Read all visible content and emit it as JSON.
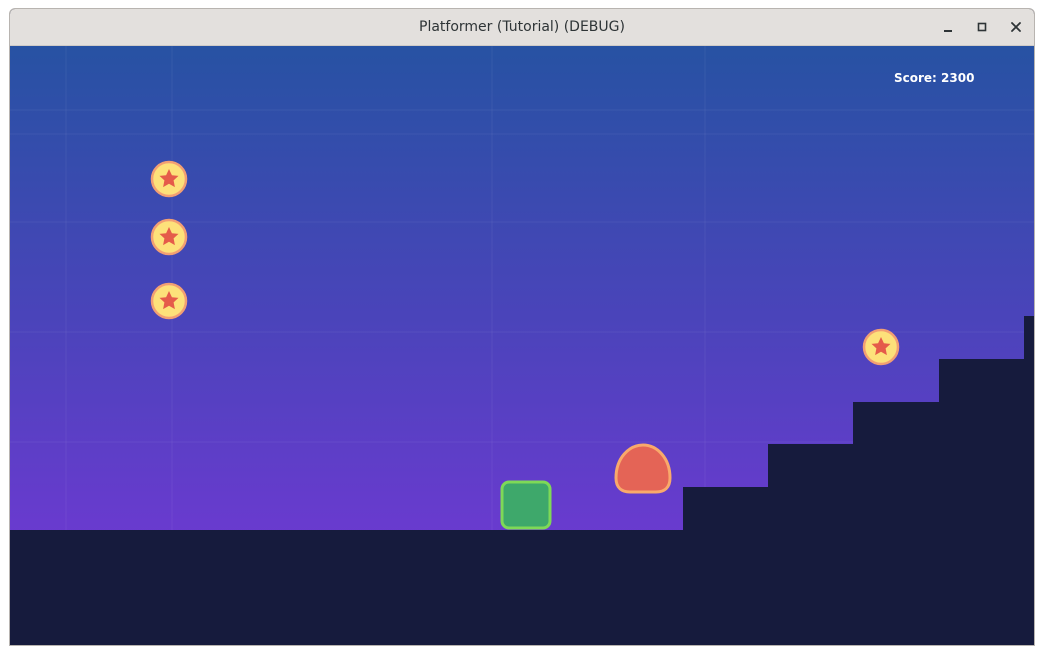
{
  "window": {
    "title": "Platformer (Tutorial) (DEBUG)",
    "controls": [
      "minimize-icon",
      "maximize-icon",
      "close-icon"
    ]
  },
  "hud": {
    "score_text": "Score: 2300"
  },
  "colors": {
    "sky_top": "#2752a3",
    "sky_bottom": "#6b3ad0",
    "ground": "#161b3d",
    "player_fill": "#3ea86b",
    "player_outline": "#7ed957",
    "enemy_fill": "#e46456",
    "enemy_outline": "#f9a96b",
    "coin_fill": "#fde17a",
    "coin_outline": "#f29f73",
    "coin_star": "#e55b4a"
  },
  "entities": {
    "player": {
      "type": "player",
      "icon": "green-square"
    },
    "enemy": {
      "type": "slime-enemy",
      "icon": "red-blob"
    },
    "coins": [
      {
        "icon": "star-coin-icon"
      },
      {
        "icon": "star-coin-icon"
      },
      {
        "icon": "star-coin-icon"
      },
      {
        "icon": "star-coin-icon"
      }
    ]
  }
}
